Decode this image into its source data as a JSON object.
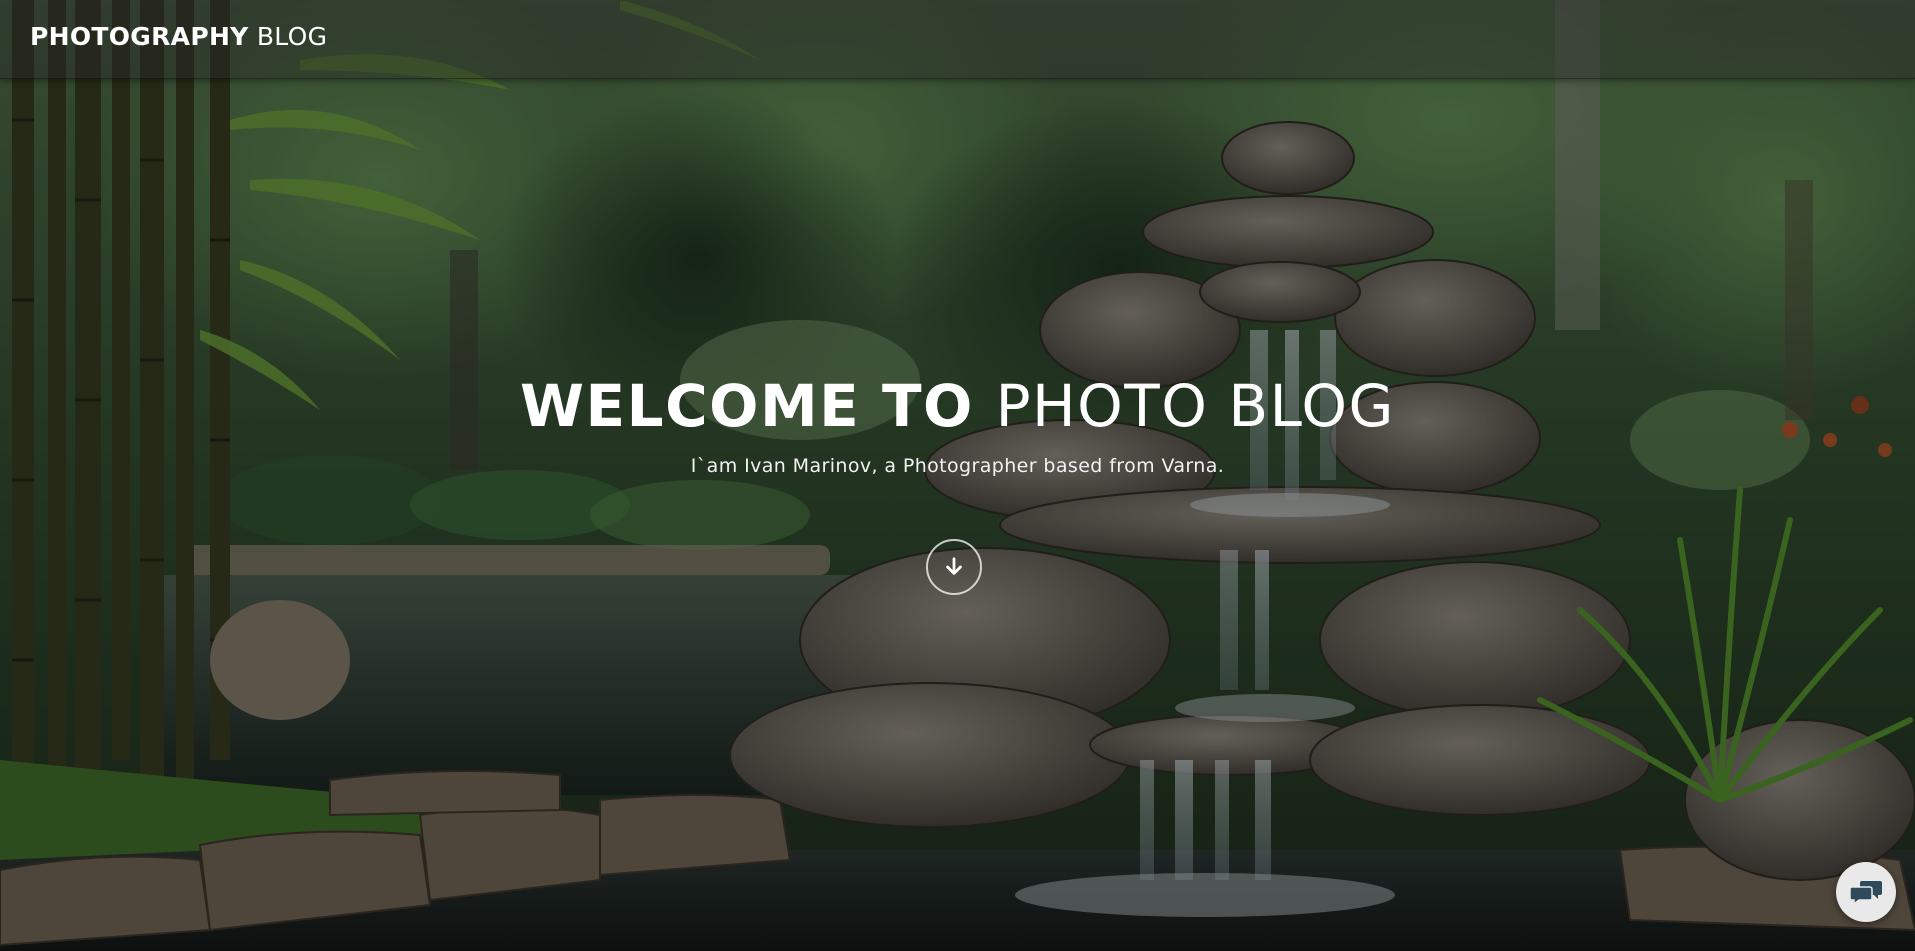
{
  "header": {
    "brand_bold": "PHOTOGRAPHY",
    "brand_light": "BLOG"
  },
  "hero": {
    "title_bold": "WELCOME TO",
    "title_light": "PHOTO BLOG",
    "subtitle": "I`am Ivan Marinov, a Photographer based from Varna."
  },
  "icons": {
    "scroll": "arrow-down-icon",
    "chat": "chat-bubbles-icon"
  },
  "colors": {
    "text": "#ffffff",
    "chat_button_bg": "#e9e9e9",
    "chat_icon": "#2f4a5a"
  }
}
